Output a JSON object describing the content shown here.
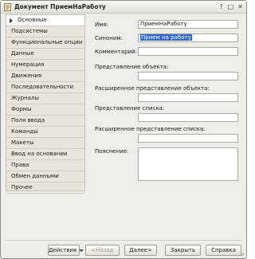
{
  "window": {
    "title": "Документ ПриемНаРаботу",
    "icons": {
      "app": "document-icon",
      "help": "help-icon",
      "maximize": "maximize-icon",
      "close": "close-icon"
    }
  },
  "nav": {
    "items": [
      {
        "label": "Основные",
        "active": true
      },
      {
        "label": "Подсистемы"
      },
      {
        "label": "Функциональные опции"
      },
      {
        "label": "Данные"
      },
      {
        "label": "Нумерация"
      },
      {
        "label": "Движения"
      },
      {
        "label": "Последовательности"
      },
      {
        "label": "Журналы"
      },
      {
        "label": "Формы"
      },
      {
        "label": "Поля ввода"
      },
      {
        "label": "Команды"
      },
      {
        "label": "Макеты"
      },
      {
        "label": "Ввод на основании"
      },
      {
        "label": "Права"
      },
      {
        "label": "Обмен данными"
      },
      {
        "label": "Прочее"
      }
    ]
  },
  "form": {
    "name_label": "Имя:",
    "name_value": "ПриемНаРаботу",
    "synonym_label": "Синоним:",
    "synonym_value": "Прием на работу",
    "comment_label": "Комментарий:",
    "comment_value": "",
    "object_repr_label": "Представление объекта:",
    "object_repr_value": "",
    "ext_object_repr_label": "Расширенное представление объекта:",
    "ext_object_repr_value": "",
    "list_repr_label": "Представление списка:",
    "list_repr_value": "",
    "ext_list_repr_label": "Расширенное представление списка:",
    "ext_list_repr_value": "",
    "explanation_label": "Пояснение:",
    "explanation_value": ""
  },
  "footer": {
    "actions": "Действия",
    "back": "<Назад",
    "next": "Далее>",
    "close": "Закрыть",
    "help": "Справка"
  }
}
